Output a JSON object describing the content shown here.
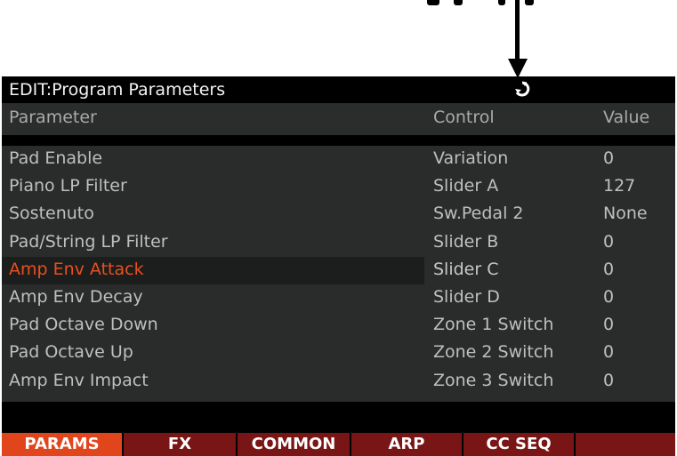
{
  "window": {
    "title": "EDIT:Program Parameters"
  },
  "columns": {
    "parameter": "Parameter",
    "control": "Control",
    "value": "Value"
  },
  "rows": [
    {
      "parameter": "Pad Enable",
      "control": "Variation",
      "value": "0"
    },
    {
      "parameter": "Piano LP Filter",
      "control": "Slider A",
      "value": "127"
    },
    {
      "parameter": "Sostenuto",
      "control": "Sw.Pedal 2",
      "value": "None"
    },
    {
      "parameter": "Pad/String LP Filter",
      "control": "Slider B",
      "value": "0"
    },
    {
      "parameter": "Amp Env Attack",
      "control": "Slider C",
      "value": "0"
    },
    {
      "parameter": "Amp Env Decay",
      "control": "Slider D",
      "value": "0"
    },
    {
      "parameter": "Pad Octave Down",
      "control": "Zone 1 Switch",
      "value": "0"
    },
    {
      "parameter": "Pad Octave Up",
      "control": "Zone 2 Switch",
      "value": "0"
    },
    {
      "parameter": "Amp Env Impact",
      "control": "Zone 3 Switch",
      "value": "0"
    }
  ],
  "selected_row_index": 4,
  "tabs": [
    {
      "label": "PARAMS",
      "active": true
    },
    {
      "label": "FX",
      "active": false
    },
    {
      "label": "COMMON",
      "active": false
    },
    {
      "label": "ARP",
      "active": false
    },
    {
      "label": "CC SEQ",
      "active": false
    },
    {
      "label": "",
      "active": false
    }
  ],
  "colors": {
    "screen_bg": "#2a2c2b",
    "title_bg": "#000000",
    "text": "#bfbfbf",
    "selected_text": "#e8501f",
    "tab_bg": "#7a1515",
    "tab_active_bg": "#e0451c"
  },
  "icons": {
    "title_status": "sync-icon",
    "pointer": "arrow-down-icon"
  }
}
